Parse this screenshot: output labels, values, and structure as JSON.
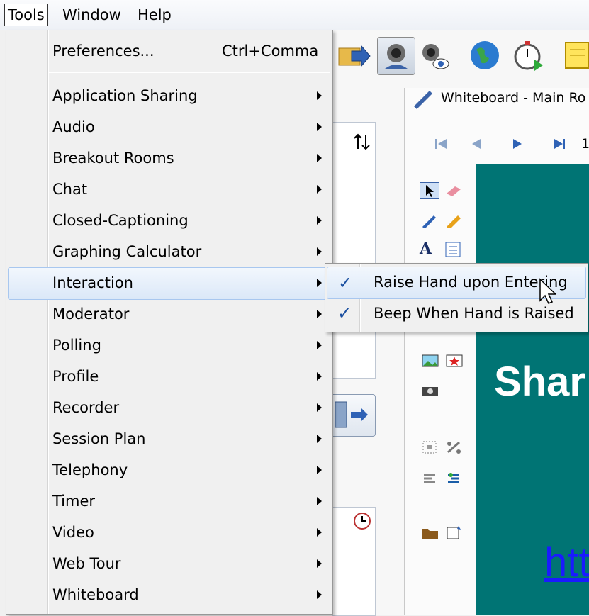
{
  "menubar": {
    "items": [
      {
        "label": "Tools",
        "mnemonic": "T",
        "active": true
      },
      {
        "label": "Window",
        "mnemonic": "W",
        "active": false
      },
      {
        "label": "Help",
        "mnemonic": "H",
        "active": false
      }
    ]
  },
  "tools_menu": {
    "preferences": {
      "label": "Preferences...",
      "shortcut": "Ctrl+Comma"
    },
    "items": [
      {
        "label": "Application Sharing"
      },
      {
        "label": "Audio"
      },
      {
        "label": "Breakout Rooms"
      },
      {
        "label": "Chat"
      },
      {
        "label": "Closed-Captioning"
      },
      {
        "label": "Graphing Calculator"
      },
      {
        "label": "Interaction",
        "highlighted": true
      },
      {
        "label": "Moderator"
      },
      {
        "label": "Polling"
      },
      {
        "label": "Profile"
      },
      {
        "label": "Recorder"
      },
      {
        "label": "Session Plan"
      },
      {
        "label": "Telephony"
      },
      {
        "label": "Timer"
      },
      {
        "label": "Video"
      },
      {
        "label": "Web Tour"
      },
      {
        "label": "Whiteboard"
      }
    ]
  },
  "interaction_submenu": {
    "items": [
      {
        "label": "Raise Hand upon Entering",
        "checked": true,
        "highlighted": true
      },
      {
        "label": "Beep When Hand is Raised",
        "checked": true
      }
    ],
    "check_glyph": "✓"
  },
  "whiteboard": {
    "title": "Whiteboard - Main Ro",
    "page_indicator": "1",
    "slide_text": "Shar",
    "slide_link": "htt"
  },
  "colors": {
    "slide_background": "#007474",
    "highlight": "#dbe8f8",
    "link": "#1a1aff"
  },
  "icons": [
    "folder-arrow-icon",
    "webcam-icon",
    "webcam-view-icon",
    "globe-icon",
    "stopwatch-icon",
    "notepad-icon",
    "pointer-icon",
    "eraser-icon",
    "pen-icon",
    "marker-icon",
    "text-icon",
    "textbox-icon",
    "image-icon",
    "clipart-icon",
    "camera-icon",
    "exit-room-icon",
    "clock-icon",
    "sort-icon",
    "mouse-cursor-icon"
  ]
}
